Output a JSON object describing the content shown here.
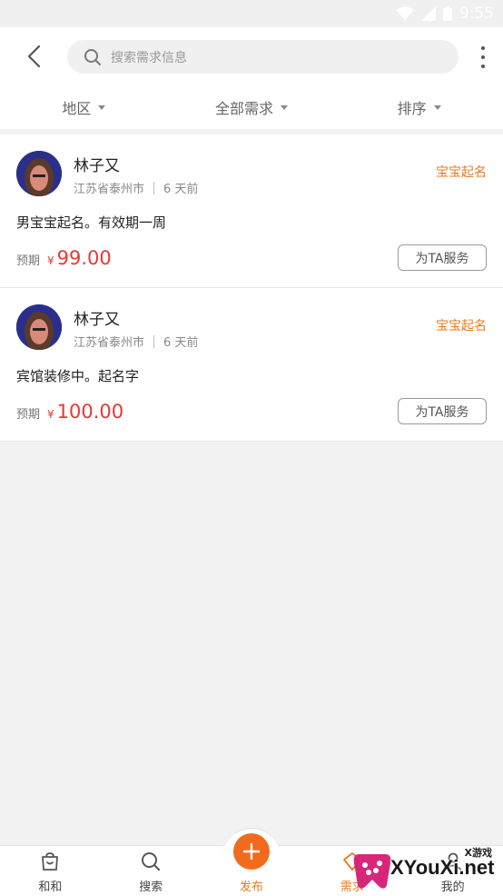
{
  "status_bar": {
    "time": "9:55"
  },
  "header": {
    "search_placeholder": "搜索需求信息"
  },
  "filters": [
    {
      "label": "地区"
    },
    {
      "label": "全部需求"
    },
    {
      "label": "排序"
    }
  ],
  "posts": [
    {
      "user": "林子又",
      "location": "江苏省泰州市",
      "time": "6 天前",
      "category": "宝宝起名",
      "description": "男宝宝起名。有效期一周",
      "price_label": "预期",
      "currency": "¥",
      "price": "99.00",
      "action": "为TA服务"
    },
    {
      "user": "林子又",
      "location": "江苏省泰州市",
      "time": "6 天前",
      "category": "宝宝起名",
      "description": "宾馆装修中。起名字",
      "price_label": "预期",
      "currency": "¥",
      "price": "100.00",
      "action": "为TA服务"
    }
  ],
  "tabbar": [
    {
      "label": "和和",
      "icon": "bag-icon"
    },
    {
      "label": "搜索",
      "icon": "search-icon"
    },
    {
      "label": "发布",
      "icon": "plus-icon"
    },
    {
      "label": "需求",
      "icon": "demand-icon"
    },
    {
      "label": "我的",
      "icon": "user-icon"
    }
  ],
  "watermark": {
    "text": "XYouXi.net",
    "tag": "X游戏"
  },
  "colors": {
    "accent": "#f26b1d",
    "category": "#e87b1c",
    "price": "#e53935"
  }
}
